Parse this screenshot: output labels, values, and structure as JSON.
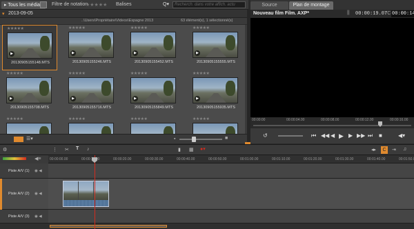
{
  "library": {
    "all_media_tab": "Tous les médias",
    "rating_filter_label": "Filtre de notation",
    "rating_stars": "★★★★★",
    "tags_label": "Balises",
    "search_placeholder": "Recherch. dans votre affich. actu",
    "folder_date": "2013-09-05",
    "folder_path": "..\\Users\\Propriétaire\\Videos\\Espagne 2013",
    "folder_count": "63 élément(s), 1 sélectionné(s)",
    "clips": [
      {
        "label": "20130905155148.MTS",
        "stars": "★★★★★",
        "selected": true
      },
      {
        "label": "20130905155246.MTS",
        "stars": "★★★★★"
      },
      {
        "label": "20130905155452.MTS",
        "stars": "★★★★★"
      },
      {
        "label": "20130905155555.MTS",
        "stars": "★★★★★"
      },
      {
        "label": "20130905155708.MTS",
        "stars": "★★★★★"
      },
      {
        "label": "20130905155716.MTS",
        "stars": "★★★★★"
      },
      {
        "label": "20130905155849.MTS",
        "stars": "★★★★★"
      },
      {
        "label": "20130905155935.MTS",
        "stars": "★★★★★"
      },
      {
        "label": "",
        "stars": "★★★★★"
      },
      {
        "label": "",
        "stars": "★★★★★"
      },
      {
        "label": "",
        "stars": "★★★★★"
      },
      {
        "label": "",
        "stars": "★★★★★"
      }
    ]
  },
  "preview": {
    "source_tab": "Source",
    "timeline_tab": "Plan de montage",
    "title": "Nouveau film Film. AXP*",
    "timecode": "00:00:19.07",
    "tc_label": "TC",
    "tc_value": "00:00:14.07",
    "ruler_labels": [
      "00:00:00",
      "00:00:04.00",
      "00:00:08.00",
      "00:00:12.00",
      "00:00:16.00"
    ]
  },
  "timeline": {
    "ruler_labels": [
      "00:00:00.00",
      "00:00:10.00",
      "00:00:20.00",
      "00:00:30.00",
      "00:00:40.00",
      "00:00:50.00",
      "00:01:00.00",
      "00:01:10.00",
      "00:01:20.00",
      "00:01:30.00",
      "00:01:40.00",
      "00:01:50.00"
    ],
    "tracks": [
      {
        "name": "Piste A/V (1)"
      },
      {
        "name": "Piste A/V (2)"
      },
      {
        "name": "Piste A/V (3)"
      }
    ]
  },
  "colors": {
    "accent": "#e08a2e",
    "playhead": "#d52b1e",
    "clip": "#5b7aa0"
  }
}
